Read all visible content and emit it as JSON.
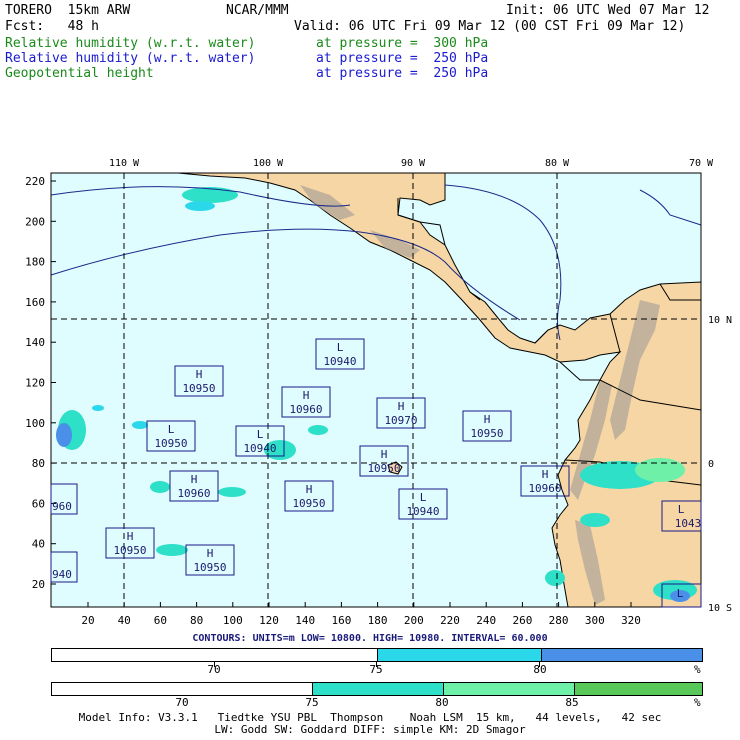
{
  "header": {
    "model": "TORERO  15km ARW",
    "center": "NCAR/MMM",
    "init": "Init: 06 UTC Wed 07 Mar 12",
    "fcst": "Fcst:   48 h",
    "valid": "Valid: 06 UTC Fri 09 Mar 12 (00 CST Fri 09 Mar 12)",
    "fields": [
      {
        "name": "Relative humidity (w.r.t. water)",
        "level": "at pressure =  300 hPa",
        "color": "#1a8a1a"
      },
      {
        "name": "Relative humidity (w.r.t. water)",
        "level": "at pressure =  250 hPa",
        "color": "#1a1ad0"
      },
      {
        "name": "Geopotential height",
        "level": "at pressure =  250 hPa",
        "color": "#000000"
      }
    ]
  },
  "map": {
    "ocean_color": "#dffcff",
    "land_color": "#f5d6a4",
    "lon_labels": [
      "110 W",
      "100 W",
      "90 W",
      "80 W",
      "70 W"
    ],
    "lat_labels": [
      "10 N",
      "0",
      "10 S"
    ],
    "y_ticks": [
      "220",
      "200",
      "180",
      "160",
      "140",
      "120",
      "100",
      "80",
      "60",
      "40",
      "20"
    ],
    "x_ticks": [
      "20",
      "40",
      "60",
      "80",
      "100",
      "120",
      "140",
      "160",
      "180",
      "200",
      "220",
      "240",
      "260",
      "280",
      "300",
      "320"
    ],
    "centers": [
      {
        "type": "H",
        "value": "10950"
      },
      {
        "type": "L",
        "value": "10940"
      },
      {
        "type": "H",
        "value": "10960"
      },
      {
        "type": "L",
        "value": "10950"
      },
      {
        "type": "L",
        "value": "10940"
      },
      {
        "type": "H",
        "value": "10970"
      },
      {
        "type": "H",
        "value": "10950"
      },
      {
        "type": "H",
        "value": "10950"
      },
      {
        "type": "H",
        "value": "10960"
      },
      {
        "type": "H",
        "value": "10950"
      },
      {
        "type": "L",
        "value": "10940"
      },
      {
        "type": "H",
        "value": "10960"
      },
      {
        "type": "H",
        "value": "10950"
      },
      {
        "type": "H",
        "value": "10950"
      },
      {
        "type": "L",
        "value": "1043"
      },
      {
        "type": "",
        "value": "960"
      },
      {
        "type": "",
        "value": "940"
      },
      {
        "type": "H",
        "value": "10960"
      },
      {
        "type": "L",
        "value": ""
      }
    ]
  },
  "contours": {
    "text": "CONTOURS:  UNITS=m  LOW=  10800.      HIGH=  10980.    INTERVAL=   60.000"
  },
  "colorbars": [
    {
      "segments": [
        {
          "color": "#ffffff"
        },
        {
          "color": "#2ad8ea"
        },
        {
          "color": "#4a90e8"
        }
      ],
      "labels": [
        "70",
        "75",
        "80"
      ],
      "unit": "%"
    },
    {
      "segments": [
        {
          "color": "#ffffff"
        },
        {
          "color": "#2ee0c8"
        },
        {
          "color": "#6ef0a8"
        },
        {
          "color": "#58c858"
        }
      ],
      "labels": [
        "70",
        "75",
        "80",
        "85"
      ],
      "unit": "%"
    }
  ],
  "footer": {
    "line1": "Model Info: V3.3.1   Tiedtke YSU PBL  Thompson    Noah LSM  15 km,   44 levels,   42 sec",
    "line2": "LW: Godd SW: Goddard DIFF: simple KM: 2D Smagor"
  }
}
